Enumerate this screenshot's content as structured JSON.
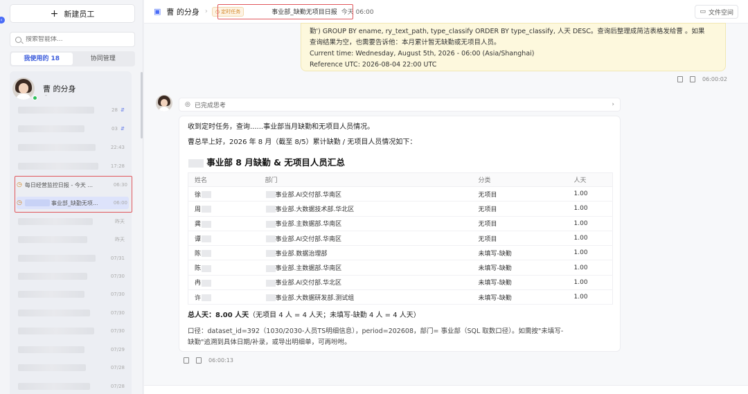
{
  "sidebar": {
    "new_button": "新建员工",
    "search_placeholder": "搜索智能体...",
    "tabs": [
      {
        "label": "我使用的 18",
        "active": true
      },
      {
        "label": "协同管理",
        "active": false
      }
    ],
    "agent_name": "曹       的分身",
    "agent_sub": "-",
    "conversations": [
      {
        "time": "28",
        "pinned": true
      },
      {
        "time": "03",
        "pinned": true
      },
      {
        "time": "22:43"
      },
      {
        "time": "17:28"
      },
      {
        "label": "每日经营监控日报 - 今天 ...",
        "time": "06:30",
        "scheduled": true
      },
      {
        "label": "事业部_缺勤无项...",
        "time": "06:00",
        "scheduled": true,
        "selected": true
      },
      {
        "time": "昨天"
      },
      {
        "time": "昨天"
      },
      {
        "time": "07/31"
      },
      {
        "time": "07/30"
      },
      {
        "time": "07/30"
      },
      {
        "time": "07/30"
      },
      {
        "time": "07/30"
      },
      {
        "time": "07/29"
      },
      {
        "time": "07/28"
      },
      {
        "time": "07/28"
      }
    ]
  },
  "header": {
    "title": "曹       的分身",
    "badge": "定时任务",
    "task": "事业部_缺勤无项目日报",
    "time": "今天 06:00",
    "files_button": "文件空间"
  },
  "user_message": {
    "lines": [
      "勤') GROUP BY ename, ry_text_path, type_classify ORDER BY type_classify, 人天 DESC。查询后整理成简洁表格发给曹        。如果",
      "查询结果为空，也需要告诉他：本月累计暂无缺勤或无项目人员。",
      "Current time: Wednesday, August 5th, 2026 - 06:00 (Asia/Shanghai)",
      "Reference UTC: 2026-08-04 22:00 UTC"
    ],
    "time": "06:00:02"
  },
  "thinking": {
    "label": "已完成思考"
  },
  "answer": {
    "line1": "收到定时任务，查询......事业部当月缺勤和无项目人员情况。",
    "line2": "曹总早上好，2026 年 8 月（截至 8/5）累计缺勤 / 无项目人员情况如下：",
    "heading": "事业部 8 月缺勤 & 无项目人员汇总",
    "columns": [
      "姓名",
      "部门",
      "分类",
      "人天"
    ],
    "rows": [
      {
        "name": "徐",
        "dept": "事业部.AI交付部.华南区",
        "type": "无项目",
        "days": "1.00"
      },
      {
        "name": "周",
        "dept": "事业部.大数据技术部.华北区",
        "type": "无项目",
        "days": "1.00"
      },
      {
        "name": "龚",
        "dept": "事业部.主数据部.华南区",
        "type": "无项目",
        "days": "1.00"
      },
      {
        "name": "谭",
        "dept": "事业部.AI交付部.华南区",
        "type": "无项目",
        "days": "1.00"
      },
      {
        "name": "陈",
        "dept": "事业部.数据治理部",
        "type": "未填写-缺勤",
        "days": "1.00"
      },
      {
        "name": "陈",
        "dept": "事业部.主数据部.华南区",
        "type": "未填写-缺勤",
        "days": "1.00"
      },
      {
        "name": "冉",
        "dept": "事业部.AI交付部.华北区",
        "type": "未填写-缺勤",
        "days": "1.00"
      },
      {
        "name": "许",
        "dept": "事业部.大数据研发部.测试组",
        "type": "未填写-缺勤",
        "days": "1.00"
      }
    ],
    "total_label": "总人天：8.00 人天",
    "total_detail": "（无项目 4 人 = 4 人天；未填写-缺勤 4 人 = 4 人天）",
    "footnote_1": "口径：dataset_id=392（1030/2030-人员TS明细信息），period=202608，部门=         事业部（SQL 取数口径）。如需按\"未填写-",
    "footnote_2": "缺勤\"追溯到具体日期/补录，或导出明细单，可再吩咐。",
    "time": "06:00:13"
  }
}
